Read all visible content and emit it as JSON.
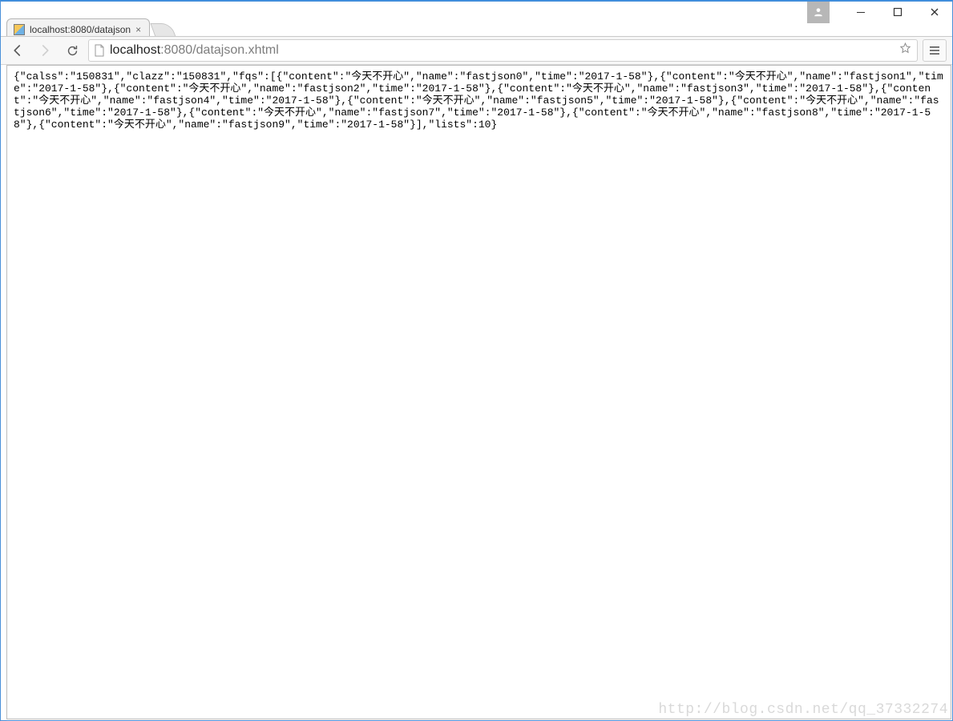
{
  "window": {
    "user_icon_alt": "user"
  },
  "tab": {
    "title": "localhost:8080/datajson",
    "close_glyph": "×"
  },
  "toolbar": {
    "url_host": "localhost",
    "url_port_path": ":8080/datajson.xhtml"
  },
  "response": {
    "calss": "150831",
    "clazz": "150831",
    "fqs": [
      {
        "content": "今天不开心",
        "name": "fastjson0",
        "time": "2017-1-58"
      },
      {
        "content": "今天不开心",
        "name": "fastjson1",
        "time": "2017-1-58"
      },
      {
        "content": "今天不开心",
        "name": "fastjson2",
        "time": "2017-1-58"
      },
      {
        "content": "今天不开心",
        "name": "fastjson3",
        "time": "2017-1-58"
      },
      {
        "content": "今天不开心",
        "name": "fastjson4",
        "time": "2017-1-58"
      },
      {
        "content": "今天不开心",
        "name": "fastjson5",
        "time": "2017-1-58"
      },
      {
        "content": "今天不开心",
        "name": "fastjson6",
        "time": "2017-1-58"
      },
      {
        "content": "今天不开心",
        "name": "fastjson7",
        "time": "2017-1-58"
      },
      {
        "content": "今天不开心",
        "name": "fastjson8",
        "time": "2017-1-58"
      },
      {
        "content": "今天不开心",
        "name": "fastjson9",
        "time": "2017-1-58"
      }
    ],
    "lists": 10
  },
  "watermark": {
    "text": "http://blog.csdn.net/qq_37332274"
  }
}
